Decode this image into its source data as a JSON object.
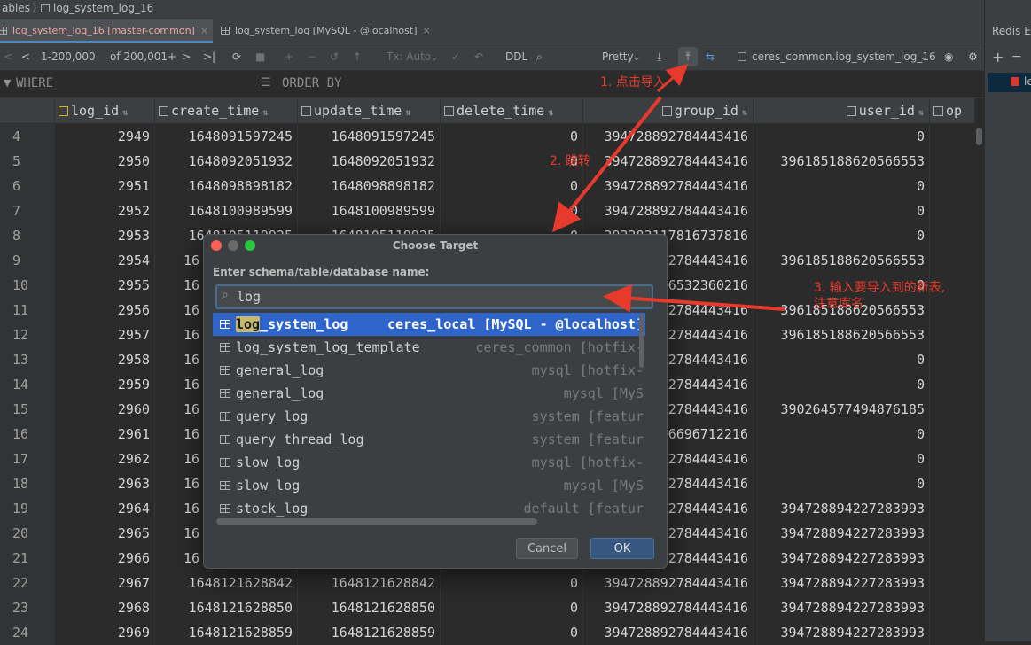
{
  "breadcrumb": {
    "parent": "ables",
    "current": "log_system_log_16"
  },
  "tabs": [
    {
      "label": "log_system_log_16 [master-common]",
      "close": "×"
    },
    {
      "label": "log_system_log [MySQL - @localhost]",
      "close": "×"
    }
  ],
  "right_panel": {
    "title": "Redis E",
    "item": "le"
  },
  "toolbar": {
    "page_range": "1-200,000",
    "total": "of 200,001+",
    "tx_mode": "Tx: Auto",
    "ddl": "DDL",
    "pretty": "Pretty",
    "target_table": "ceres_common.log_system_log_16"
  },
  "filter": {
    "where": "WHERE",
    "order_by": "ORDER BY"
  },
  "grid": {
    "columns": [
      "log_id",
      "create_time",
      "update_time",
      "delete_time",
      "group_id",
      "user_id",
      "op"
    ],
    "rows": [
      {
        "n": "4",
        "c": [
          "2949",
          "1648091597245",
          "1648091597245",
          "0",
          "394728892784443416",
          "0"
        ]
      },
      {
        "n": "5",
        "c": [
          "2950",
          "1648092051932",
          "1648092051932",
          "0",
          "394728892784443416",
          "396185188620566553"
        ]
      },
      {
        "n": "6",
        "c": [
          "2951",
          "1648098898182",
          "1648098898182",
          "0",
          "394728892784443416",
          "0"
        ]
      },
      {
        "n": "7",
        "c": [
          "2952",
          "1648100989599",
          "1648100989599",
          "0",
          "394728892784443416",
          "0"
        ]
      },
      {
        "n": "8",
        "c": [
          "2953",
          "1648105119925",
          "1648105119925",
          "0",
          "393383117816737816",
          "0"
        ]
      },
      {
        "n": "9",
        "c": [
          "2954",
          "16",
          "",
          "",
          "2784443416",
          "396185188620566553"
        ]
      },
      {
        "n": "10",
        "c": [
          "2955",
          "16",
          "",
          "",
          "6532360216",
          "0"
        ]
      },
      {
        "n": "11",
        "c": [
          "2956",
          "16",
          "",
          "",
          "2784443416",
          "396185188620566553"
        ]
      },
      {
        "n": "12",
        "c": [
          "2957",
          "16",
          "",
          "",
          "2784443416",
          "396185188620566553"
        ]
      },
      {
        "n": "13",
        "c": [
          "2958",
          "16",
          "",
          "",
          "2784443416",
          "0"
        ]
      },
      {
        "n": "14",
        "c": [
          "2959",
          "16",
          "",
          "",
          "2784443416",
          "0"
        ]
      },
      {
        "n": "15",
        "c": [
          "2960",
          "16",
          "",
          "",
          "2784443416",
          "390264577494876185"
        ]
      },
      {
        "n": "16",
        "c": [
          "2961",
          "16",
          "",
          "",
          "6696712216",
          "0"
        ]
      },
      {
        "n": "17",
        "c": [
          "2962",
          "16",
          "",
          "",
          "2784443416",
          "0"
        ]
      },
      {
        "n": "18",
        "c": [
          "2963",
          "16",
          "",
          "",
          "2784443416",
          "0"
        ]
      },
      {
        "n": "19",
        "c": [
          "2964",
          "16",
          "",
          "",
          "2784443416",
          "394728894227283993"
        ]
      },
      {
        "n": "20",
        "c": [
          "2965",
          "16",
          "",
          "",
          "2784443416",
          "394728894227283993"
        ]
      },
      {
        "n": "21",
        "c": [
          "2966",
          "16",
          "",
          "",
          "2784443416",
          "394728894227283993"
        ]
      },
      {
        "n": "22",
        "c": [
          "2967",
          "1648121628842",
          "1648121628842",
          "0",
          "394728892784443416",
          "394728894227283993"
        ]
      },
      {
        "n": "23",
        "c": [
          "2968",
          "1648121628850",
          "1648121628850",
          "0",
          "394728892784443416",
          "394728894227283993"
        ]
      },
      {
        "n": "24",
        "c": [
          "2969",
          "1648121628859",
          "1648121628859",
          "0",
          "394728892784443416",
          "394728894227283993"
        ]
      }
    ]
  },
  "dialog": {
    "title": "Choose Target",
    "label": "Enter schema/table/database name:",
    "search_value": "log",
    "items": [
      {
        "match": "log",
        "rest": "_system_log",
        "source": "ceres_local [MySQL - @localhost]",
        "selected": true
      },
      {
        "match": "",
        "rest": "log_system_log_template",
        "source": "ceres_common [hotfix-",
        "selected": false
      },
      {
        "match": "",
        "rest": "general_log",
        "source": "mysql [hotfix-",
        "selected": false
      },
      {
        "match": "",
        "rest": "general_log",
        "source": "mysql [MyS",
        "selected": false
      },
      {
        "match": "",
        "rest": "query_log",
        "source": "system [featur",
        "selected": false
      },
      {
        "match": "",
        "rest": "query_thread_log",
        "source": "system [featur",
        "selected": false
      },
      {
        "match": "",
        "rest": "slow_log",
        "source": "mysql [hotfix-",
        "selected": false
      },
      {
        "match": "",
        "rest": "slow_log",
        "source": "mysql [MyS",
        "selected": false
      },
      {
        "match": "",
        "rest": "stock_log",
        "source": "default [featur",
        "selected": false
      }
    ],
    "cancel": "Cancel",
    "ok": "OK"
  },
  "annotations": {
    "step1": "1. 点击导入",
    "step2": "2. 跳转",
    "step3_line1": "3. 输入要导入到的新表,",
    "step3_line2": "注意库名"
  },
  "colors": {
    "selection": "#2f65ca",
    "annotation": "#e8392d",
    "ok_button": "#365880"
  }
}
